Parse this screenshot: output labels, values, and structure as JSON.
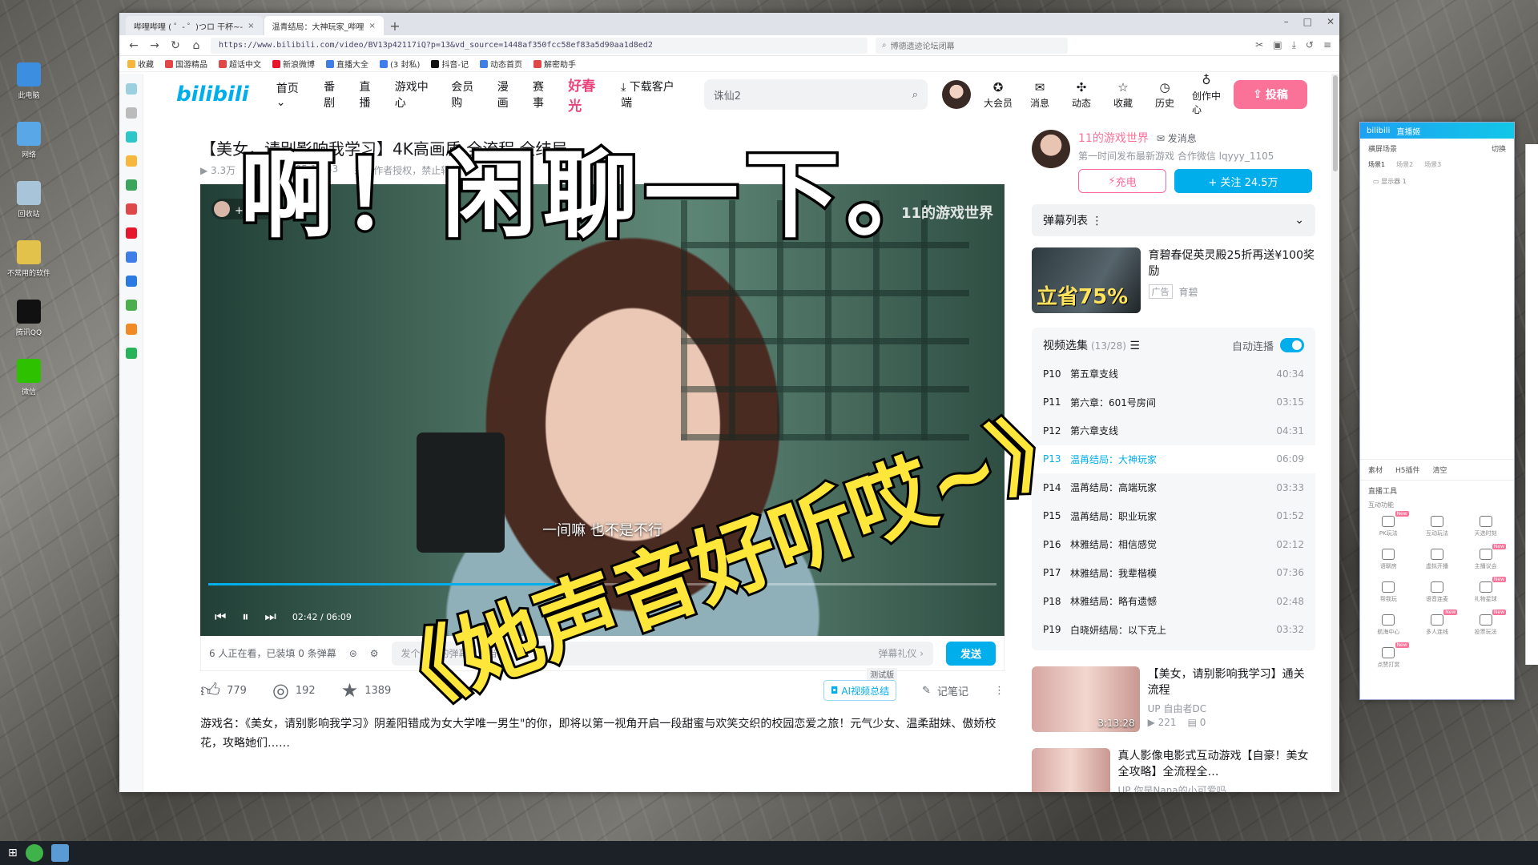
{
  "desktop": {
    "icons": [
      {
        "label": "此电脑",
        "color": "#3b8ee0"
      },
      {
        "label": "网络",
        "color": "#5aa7e8"
      },
      {
        "label": "回收站",
        "color": "#a7c4d8"
      },
      {
        "label": "不常用的软件",
        "color": "#e2c24a"
      },
      {
        "label": "腾讯QQ",
        "color": "#111111"
      },
      {
        "label": "微信",
        "color": "#2dc100"
      }
    ]
  },
  "browser": {
    "tabs": [
      {
        "label": "哔哩哔哩 ( ゜- ゜)つロ 干杯~-",
        "close": "×"
      },
      {
        "label": "温青结局：大神玩家_哔哩",
        "close": "×"
      }
    ],
    "new_tab": "+",
    "url": "https://www.bilibili.com/video/BV13p42117iQ?p=13&vd_source=1448af350fcc58ef83a5d90aa1d8ed2",
    "search_placeholder": "博德遗迹论坛闭幕",
    "bookmarks": [
      "收藏",
      "国游精品",
      "超话中文",
      "新浪微博",
      "直播大全",
      "(3 封私)",
      "抖音-记",
      "动态首页",
      "解密助手"
    ]
  },
  "header": {
    "logo": "bilibili",
    "nav": [
      "首页",
      "番剧",
      "直播",
      "游戏中心",
      "会员购",
      "漫画",
      "赛事"
    ],
    "festival": "好春光",
    "download": "下载客户端",
    "search_value": "诛仙2",
    "right_items": [
      "大会员",
      "消息",
      "动态",
      "收藏",
      "历史",
      "创作中心"
    ],
    "upload": "投稿"
  },
  "video": {
    "title": "【美女，请别影响我学习】4K高画质 全流程 全结局",
    "views": "3.3万",
    "date": "2024-01-05 12:33",
    "rights": "未经作者授权，禁止转载",
    "uploader_watermark": "11的游戏世界",
    "follow_badge": "+ 关注",
    "subtitle": "一间嘛 也不是不行",
    "time": "02:42 / 06:09",
    "progress": 0.44,
    "viewers": "6 人正在看，已装填 0 条弹幕",
    "danmaku_placeholder": "发个友善的弹幕见证当下",
    "gift": "弹幕礼仪 ›",
    "send": "发送",
    "likes": "779",
    "coins": "192",
    "favs": "1389",
    "ai_summary": "AI视频总结",
    "beta": "测试版",
    "notes": "记笔记",
    "description": "游戏名：《美女，请别影响我学习》阴差阳错成为女大学唯一男生\"的你，即将以第一视角开启一段甜蜜与欢笑交织的校园恋爱之旅！元气少女、温柔甜妹、傲娇校花，攻略她们……"
  },
  "uploader": {
    "name": "11的游戏世界",
    "message": "发消息",
    "bio": "第一时间发布最新游戏 合作微信 lqyyy_1105",
    "charge": "充电",
    "follow": "+ 关注 24.5万",
    "danmaku_list": "弹幕列表"
  },
  "ad": {
    "title": "育碧春促英灵殿25折再送¥100奖励",
    "tag": "广告",
    "brand": "育碧",
    "badge": "立省75%"
  },
  "playlist": {
    "title": "视频选集",
    "count": "(13/28)",
    "autoplay": "自动连播",
    "episodes": [
      {
        "p": "P10",
        "title": "第五章支线",
        "dur": "40:34",
        "current": false
      },
      {
        "p": "P11",
        "title": "第六章：601号房间",
        "dur": "03:15",
        "current": false
      },
      {
        "p": "P12",
        "title": "第六章支线",
        "dur": "04:31",
        "current": false
      },
      {
        "p": "P13",
        "title": "温苒结局：大神玩家",
        "dur": "06:09",
        "current": true
      },
      {
        "p": "P14",
        "title": "温苒结局：高端玩家",
        "dur": "03:33",
        "current": false
      },
      {
        "p": "P15",
        "title": "温苒结局：职业玩家",
        "dur": "01:52",
        "current": false
      },
      {
        "p": "P16",
        "title": "林雅结局：相信感觉",
        "dur": "02:12",
        "current": false
      },
      {
        "p": "P17",
        "title": "林雅结局：我辈楷模",
        "dur": "07:36",
        "current": false
      },
      {
        "p": "P18",
        "title": "林雅结局：略有遗憾",
        "dur": "02:48",
        "current": false
      },
      {
        "p": "P19",
        "title": "白晓妍结局：以下克上",
        "dur": "03:32",
        "current": false
      }
    ]
  },
  "recommend": [
    {
      "title": "【美女，请别影响我学习】通关流程",
      "up": "自由者DC",
      "views": "221",
      "danmaku": "0",
      "duration": "3:13:28"
    },
    {
      "title": "真人影像电影式互动游戏【自豪！美女全攻略】全流程全…",
      "up": "你是Nana的小可爱吗",
      "views": "",
      "danmaku": "",
      "duration": ""
    }
  ],
  "overlay": {
    "caption_top": "啊！闲聊一下。",
    "caption_bottom": "《她声音好听哎~》"
  },
  "stream_tool": {
    "title": "直播姬",
    "section_scenes": "横屏场景",
    "switch": "切换",
    "scenes": [
      "场景1",
      "场景2",
      "场景3"
    ],
    "display": "显示器 1",
    "bottom_tabs": [
      "素材",
      "H5插件",
      "清空"
    ],
    "tools_title": "直播工具",
    "tools_sub": "互动功能",
    "tools": [
      {
        "label": "PK玩法",
        "new": true
      },
      {
        "label": "互动玩法",
        "new": false
      },
      {
        "label": "天选时刻",
        "new": false
      },
      {
        "label": "语聊房",
        "new": false
      },
      {
        "label": "虚拟开播",
        "new": false
      },
      {
        "label": "主播议会",
        "new": true
      },
      {
        "label": "帮我玩",
        "new": false
      },
      {
        "label": "语音连麦",
        "new": false
      },
      {
        "label": "礼物星球",
        "new": true
      },
      {
        "label": "航海中心",
        "new": false
      },
      {
        "label": "多人连线",
        "new": true
      },
      {
        "label": "投票玩法",
        "new": true
      },
      {
        "label": "点赞打赏",
        "new": true
      }
    ]
  }
}
